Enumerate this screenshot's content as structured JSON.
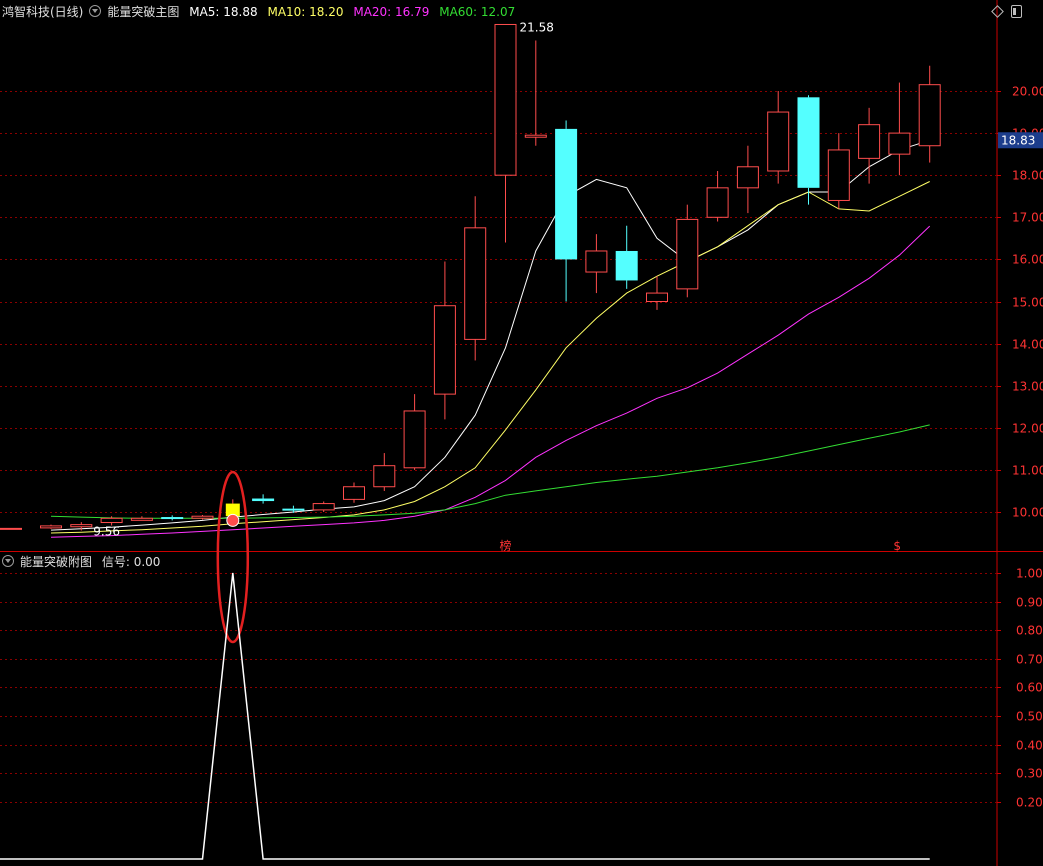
{
  "main_header": {
    "stock": "鸿智科技(日线)",
    "indicator": "能量突破主图",
    "ma5": "MA5: 18.88",
    "ma10": "MA10: 18.20",
    "ma20": "MA20: 16.79",
    "ma60": "MA60: 12.07"
  },
  "sub_header": {
    "indicator": "能量突破附图",
    "signal": "信号: 0.00"
  },
  "colors": {
    "up": "#ff4d4d",
    "down": "#54ffff",
    "ma5": "#ffffff",
    "ma10": "#ffff66",
    "ma20": "#ff33ff",
    "ma60": "#33dd33",
    "grid": "#8b0000",
    "axis": "#cc0000",
    "label": "#ff3333",
    "highlight": "#ffff00"
  },
  "icons": [
    "diamond-icon",
    "window-icon",
    "collapse-triangle-icon"
  ],
  "chart_data": [
    {
      "type": "candlestick",
      "title": "能量突破主图",
      "ylim": [
        9.3,
        21.9
      ],
      "y_ticks": [
        10.0,
        11.0,
        12.0,
        13.0,
        14.0,
        15.0,
        16.0,
        17.0,
        18.0,
        19.0,
        20.0
      ],
      "current_price": "18.83",
      "annotations": [
        {
          "text": "21.58",
          "index": 15
        },
        {
          "text": "9.56",
          "index": 1
        },
        {
          "text": "榜",
          "index": 15
        },
        {
          "text": "$",
          "index": 28
        }
      ],
      "signal_marker_index": 6,
      "candles": [
        {
          "o": 9.67,
          "c": 9.67,
          "h": 9.7,
          "l": 9.6
        },
        {
          "o": 9.65,
          "c": 9.7,
          "h": 9.76,
          "l": 9.56
        },
        {
          "o": 9.75,
          "c": 9.85,
          "h": 9.9,
          "l": 9.68
        },
        {
          "o": 9.85,
          "c": 9.85,
          "h": 9.9,
          "l": 9.8
        },
        {
          "o": 9.88,
          "c": 9.85,
          "h": 9.92,
          "l": 9.8
        },
        {
          "o": 9.86,
          "c": 9.9,
          "h": 9.93,
          "l": 9.82
        },
        {
          "o": 9.9,
          "c": 10.2,
          "h": 10.3,
          "l": 9.85
        },
        {
          "o": 10.32,
          "c": 10.26,
          "h": 10.42,
          "l": 10.2
        },
        {
          "o": 10.08,
          "c": 10.04,
          "h": 10.15,
          "l": 9.98
        },
        {
          "o": 10.05,
          "c": 10.2,
          "h": 10.25,
          "l": 10.0
        },
        {
          "o": 10.3,
          "c": 10.6,
          "h": 10.7,
          "l": 10.22
        },
        {
          "o": 10.6,
          "c": 11.1,
          "h": 11.4,
          "l": 10.5
        },
        {
          "o": 11.05,
          "c": 12.4,
          "h": 12.8,
          "l": 11.0
        },
        {
          "o": 12.8,
          "c": 14.9,
          "h": 15.95,
          "l": 12.2
        },
        {
          "o": 14.1,
          "c": 16.75,
          "h": 17.5,
          "l": 13.6
        },
        {
          "o": 18.0,
          "c": 21.58,
          "h": 21.58,
          "l": 16.4
        },
        {
          "o": 18.95,
          "c": 18.95,
          "h": 21.2,
          "l": 18.7
        },
        {
          "o": 19.1,
          "c": 16.0,
          "h": 19.3,
          "l": 15.0
        },
        {
          "o": 15.7,
          "c": 16.2,
          "h": 16.6,
          "l": 15.2
        },
        {
          "o": 16.2,
          "c": 15.5,
          "h": 16.8,
          "l": 15.3
        },
        {
          "o": 15.0,
          "c": 15.2,
          "h": 15.6,
          "l": 14.8
        },
        {
          "o": 15.3,
          "c": 16.95,
          "h": 17.3,
          "l": 15.1
        },
        {
          "o": 17.0,
          "c": 17.7,
          "h": 18.1,
          "l": 16.9
        },
        {
          "o": 17.7,
          "c": 18.2,
          "h": 18.7,
          "l": 17.1
        },
        {
          "o": 18.1,
          "c": 19.5,
          "h": 20.0,
          "l": 17.8
        },
        {
          "o": 19.85,
          "c": 17.7,
          "h": 19.9,
          "l": 17.3
        },
        {
          "o": 17.4,
          "c": 18.6,
          "h": 19.0,
          "l": 17.2
        },
        {
          "o": 18.4,
          "c": 19.2,
          "h": 19.6,
          "l": 17.8
        },
        {
          "o": 18.5,
          "c": 19.0,
          "h": 20.2,
          "l": 18.0
        },
        {
          "o": 18.7,
          "c": 20.15,
          "h": 20.6,
          "l": 18.3
        }
      ],
      "series": [
        {
          "name": "MA5",
          "values": [
            9.57,
            9.6,
            9.64,
            9.69,
            9.74,
            9.8,
            9.88,
            9.94,
            10.0,
            10.07,
            10.12,
            10.27,
            10.6,
            11.3,
            12.3,
            13.9,
            16.2,
            17.5,
            17.9,
            17.7,
            16.5,
            15.95,
            16.3,
            16.7,
            17.3,
            17.6,
            17.6,
            18.2,
            18.6,
            18.83
          ]
        },
        {
          "name": "MA10",
          "values": [
            9.5,
            9.52,
            9.55,
            9.58,
            9.62,
            9.66,
            9.72,
            9.77,
            9.82,
            9.87,
            9.93,
            10.05,
            10.25,
            10.6,
            11.05,
            11.95,
            12.9,
            13.9,
            14.6,
            15.2,
            15.6,
            15.95,
            16.3,
            16.8,
            17.3,
            17.6,
            17.2,
            17.15,
            17.5,
            17.85
          ]
        },
        {
          "name": "MA20",
          "values": [
            9.4,
            9.42,
            9.44,
            9.47,
            9.5,
            9.54,
            9.58,
            9.62,
            9.66,
            9.7,
            9.74,
            9.8,
            9.9,
            10.05,
            10.35,
            10.75,
            11.3,
            11.7,
            12.05,
            12.35,
            12.7,
            12.95,
            13.3,
            13.75,
            14.2,
            14.7,
            15.1,
            15.55,
            16.1,
            16.79
          ]
        },
        {
          "name": "MA60",
          "values": [
            9.9,
            9.88,
            9.86,
            9.85,
            9.85,
            9.85,
            9.85,
            9.86,
            9.87,
            9.88,
            9.9,
            9.93,
            9.97,
            10.05,
            10.2,
            10.4,
            10.5,
            10.6,
            10.7,
            10.78,
            10.85,
            10.95,
            11.05,
            11.17,
            11.3,
            11.45,
            11.6,
            11.75,
            11.9,
            12.07
          ]
        }
      ]
    },
    {
      "type": "line",
      "title": "能量突破附图",
      "ylim": [
        0,
        1.05
      ],
      "y_ticks": [
        0.2,
        0.3,
        0.4,
        0.5,
        0.6,
        0.7,
        0.8,
        0.9,
        1.0
      ],
      "y_tick_labels": [
        "0.20",
        "0.30",
        "0.40",
        "0.50",
        "0.60",
        "0.70",
        "0.80",
        "0.90",
        "1.00"
      ],
      "series": [
        {
          "name": "信号",
          "values": [
            0,
            0,
            0,
            0,
            0,
            0,
            1,
            0,
            0,
            0,
            0,
            0,
            0,
            0,
            0,
            0,
            0,
            0,
            0,
            0,
            0,
            0,
            0,
            0,
            0,
            0,
            0,
            0,
            0,
            0
          ]
        }
      ]
    }
  ]
}
